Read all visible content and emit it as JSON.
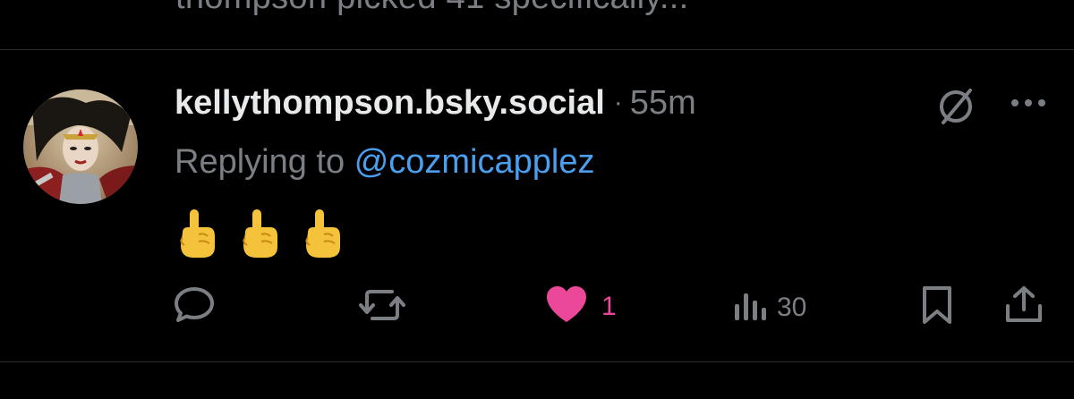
{
  "previous_post": {
    "text": "thompson picked 41 specifically..."
  },
  "post": {
    "author_handle": "kellythompson.bsky.social",
    "separator": "·",
    "timestamp": "55m",
    "reply_prefix": "Replying to",
    "reply_target": "@cozmicapplez",
    "content_emojis": [
      "👆",
      "👆",
      "👆"
    ],
    "actions": {
      "likes_count": "1",
      "views_count": "30"
    }
  },
  "colors": {
    "background": "#000000",
    "muted_text": "#7b7f84",
    "link": "#4a9fef",
    "like": "#ec4899"
  },
  "icons": {
    "top_right": [
      "no-entry-icon",
      "more-options-icon"
    ],
    "actions": [
      "reply-icon",
      "repost-icon",
      "heart-icon",
      "views-icon",
      "bookmark-icon",
      "share-icon"
    ]
  }
}
